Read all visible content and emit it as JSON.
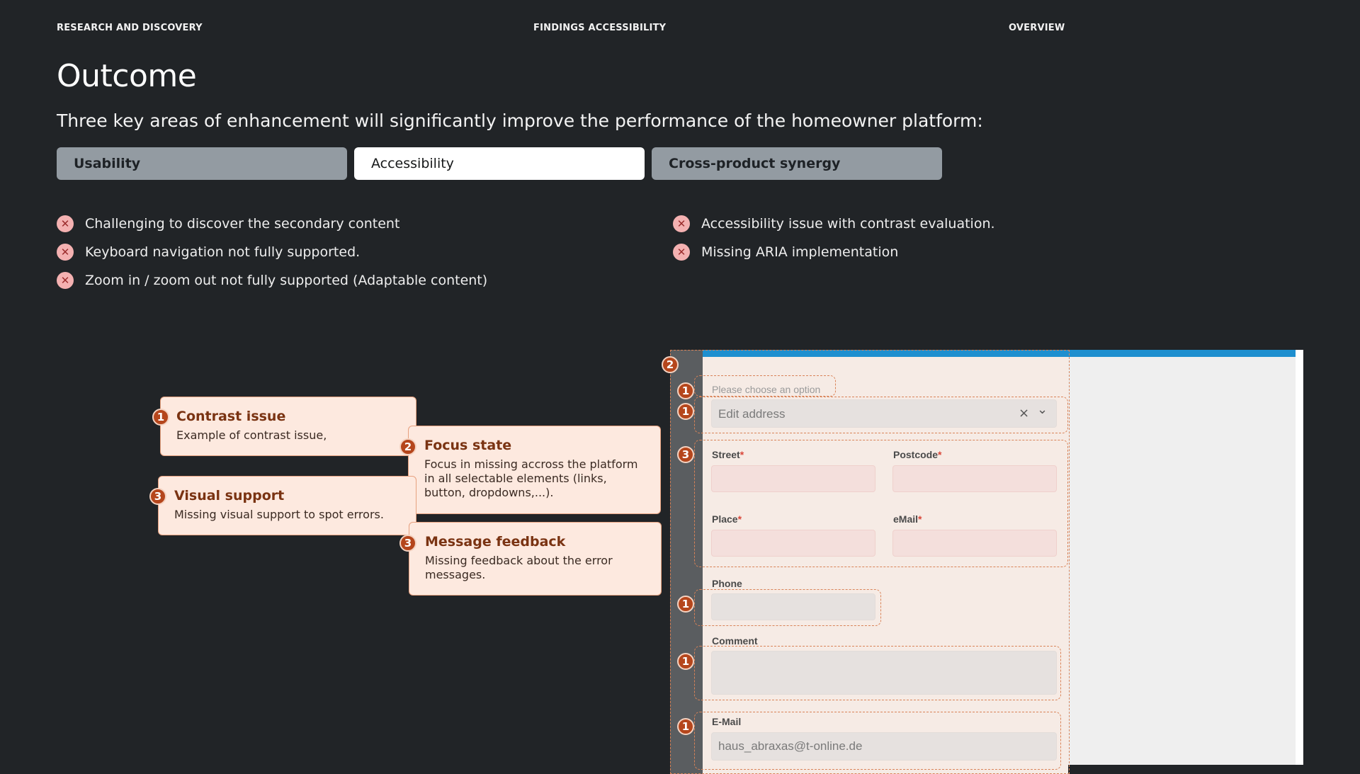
{
  "nav": {
    "left": "RESEARCH AND DISCOVERY",
    "center": "FINDINGS ACCESSIBILITY",
    "right": "OVERVIEW"
  },
  "heading": {
    "title": "Outcome",
    "subtitle": "Three key areas of enhancement will significantly improve the performance of the homeowner platform:"
  },
  "tabs": [
    {
      "label": "Usability",
      "active": false
    },
    {
      "label": "Accessibility",
      "active": true
    },
    {
      "label": "Cross-product synergy",
      "active": false
    }
  ],
  "issues_left": [
    "Challenging to discover the secondary content",
    "Keyboard navigation not fully supported.",
    "Zoom in / zoom out not fully supported (Adaptable content)"
  ],
  "issues_right": [
    "Accessibility issue with contrast evaluation.",
    "Missing ARIA implementation"
  ],
  "callouts": [
    {
      "num": "1",
      "title": "Contrast issue",
      "body": "Example of contrast issue,"
    },
    {
      "num": "2",
      "title": "Focus state",
      "body": "Focus in missing accross the platform in all selectable elements (links, button, dropdowns,...)."
    },
    {
      "num": "3",
      "title": "Visual support",
      "body": "Missing visual support to spot errors."
    },
    {
      "num": "3",
      "title": "Message feedback",
      "body": "Missing feedback about the error messages."
    }
  ],
  "form": {
    "select_placeholder": "Please choose an option",
    "select_value": "Edit address",
    "clear_icon": "×",
    "chevron_icon": "⌄",
    "street_label": "Street",
    "postcode_label": "Postcode",
    "place_label": "Place",
    "email_label": "eMail",
    "phone_label": "Phone",
    "comment_label": "Comment",
    "email2_label": "E-Mail",
    "email2_value": "haus_abraxas@t-online.de",
    "required_mark": "*"
  },
  "markers": {
    "m2": "2",
    "m1a": "1",
    "m1b": "1",
    "m3": "3",
    "m1c": "1",
    "m1d": "1",
    "m1e": "1"
  },
  "colors": {
    "background": "#212427",
    "tab_inactive": "#939ba2",
    "tab_active": "#ffffff",
    "issue_icon": "#f4b1b1",
    "callout_bg": "#fde9df",
    "badge": "#b5461c",
    "accent_bar": "#1e8fcf"
  }
}
